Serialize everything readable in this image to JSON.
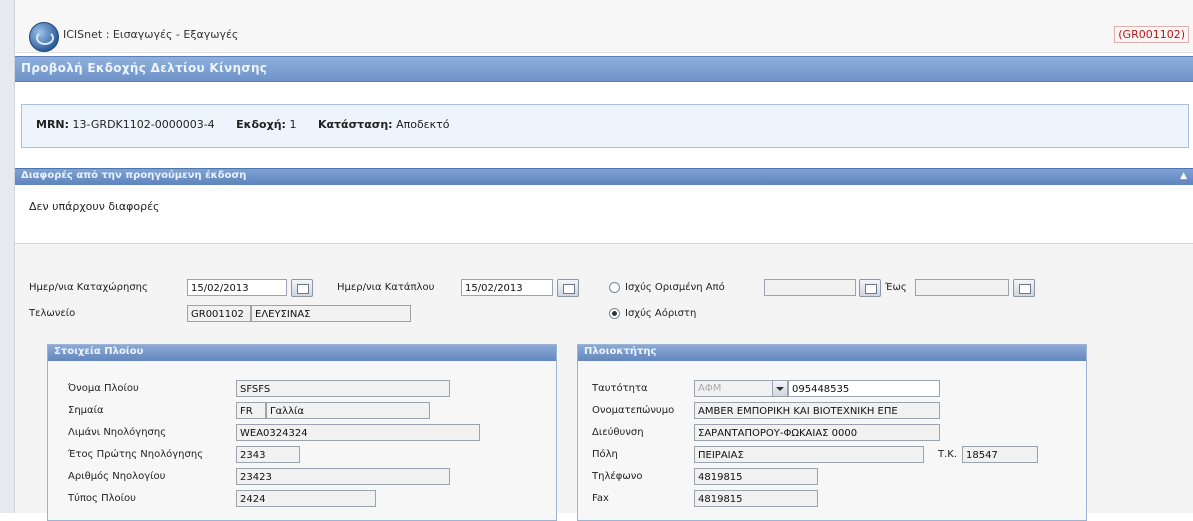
{
  "app": {
    "title": "ICISnet : Εισαγωγές - Εξαγωγές",
    "code": "(GR001102)"
  },
  "page": {
    "title": "Προβολή Εκδοχής Δελτίου Κίνησης"
  },
  "mrn": {
    "label": "MRN:",
    "value": "13-GRDK1102-0000003-4",
    "version_label": "Εκδοχή:",
    "version_value": "1",
    "status_label": "Κατάσταση:",
    "status_value": "Αποδεκτό"
  },
  "differences": {
    "title": "Διαφορές από την προηγούμενη έκδοση",
    "text": "Δεν υπάρχουν διαφορές"
  },
  "filters": {
    "reg_date_label": "Ημερ/νια Καταχώρησης",
    "reg_date_value": "15/02/2013",
    "state_date_label": "Ημερ/νια Κατάπλου",
    "state_date_value": "15/02/2013",
    "customs_label": "Τελωνείο",
    "customs_code": "GR001102",
    "customs_name": "ΕΛΕΥΣΙΝΑΣ",
    "valid_from_label": "Ισχύς Ορισμένη Από",
    "valid_from_value": "",
    "until_label": "Έως",
    "until_value": "",
    "unlimited_label": "Ισχύς Αόριστη"
  },
  "ship": {
    "title": "Στοιχεία Πλοίου",
    "fields": [
      {
        "label": "Όνομα Πλοίου",
        "value": "SFSFS"
      },
      {
        "label": "Σημαία",
        "code": "FR",
        "value": "Γαλλία"
      },
      {
        "label": "Λιμάνι Νηολόγησης",
        "value": "WEA0324324"
      },
      {
        "label": "Έτος Πρώτης Νηολόγησης",
        "value": "2343"
      },
      {
        "label": "Αριθμός Νηολογίου",
        "value": "23423"
      },
      {
        "label": "Τύπος Πλοίου",
        "value": "2424"
      }
    ]
  },
  "captain": {
    "title": "Πλοιοκτήτης",
    "fields": [
      {
        "label": "Ταυτότητα",
        "type": "ΑΦΜ",
        "value": "095448535"
      },
      {
        "label": "Ονοματεπώνυμο",
        "value": "AMBER ΕΜΠΟΡΙΚΗ ΚΑΙ ΒΙΟΤΕΧΝΙΚΗ ΕΠΕ"
      },
      {
        "label": "Διεύθυνση",
        "value": "ΣΑΡΑΝΤΑΠΟΡΟΥ-ΦΩΚΑΙΑΣ 0000"
      },
      {
        "label": "Πόλη",
        "value": "ΠΕΙΡΑΙΑΣ",
        "postal_label": "Τ.Κ.",
        "postal_value": "18547"
      },
      {
        "label": "Τηλέφωνο",
        "value": "4819815"
      },
      {
        "label": "Fax",
        "value": "4819815"
      }
    ]
  }
}
